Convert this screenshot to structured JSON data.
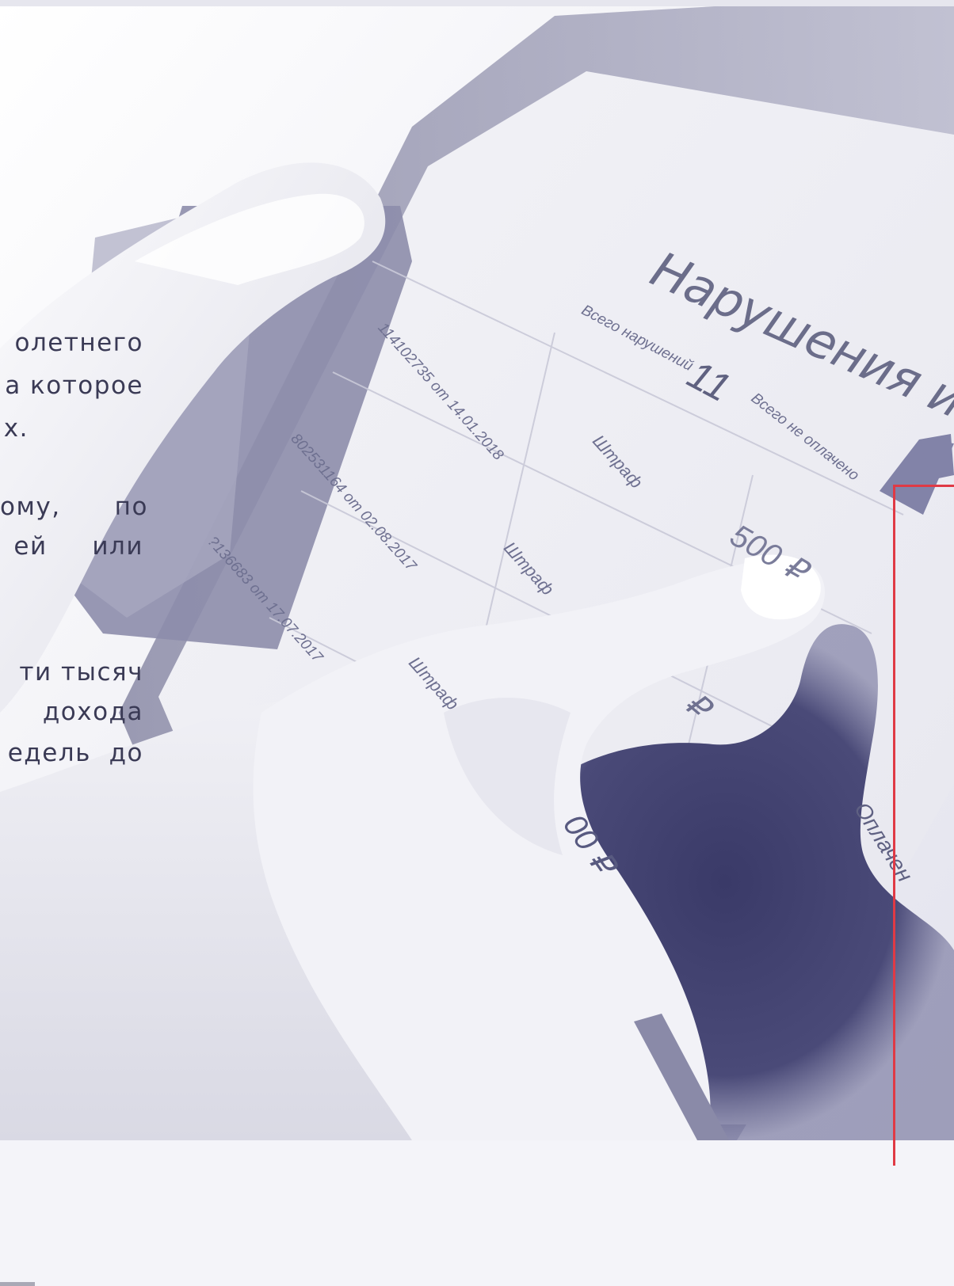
{
  "text_lines": [
    "олетнего",
    "а которое",
    "х.",
    "ому,      по",
    "ей     или",
    "ти тысяч",
    "дохода",
    "едель  до"
  ],
  "tablet": {
    "title": "Нарушения и штраф",
    "total_violations_label": "Всего нарушений",
    "total_violations_value": "11",
    "unpaid_label": "Всего не оплачено",
    "rows": [
      {
        "id": "114102735 от 14.01.2018",
        "type": "Штраф"
      },
      {
        "id": "802531164 от 02.08.2017",
        "type": "Штраф"
      },
      {
        "id": "?136683 от 17.07.2017",
        "type": "Штраф"
      }
    ],
    "amount_1": "500 ₽",
    "amount_2": "₽",
    "amount_3": "00 ₽",
    "status": "Оплачен"
  },
  "colors": {
    "accent_red": "#e03a45",
    "tint": "#3d3d6b",
    "text": "#3a3a55"
  }
}
